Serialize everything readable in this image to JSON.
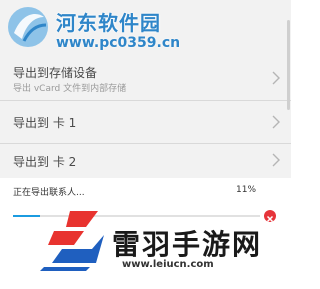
{
  "export_options": [
    {
      "title": "导出到存储设备",
      "subtitle": "导出 vCard 文件到内部存储"
    },
    {
      "title": "导出到 卡 1"
    },
    {
      "title": "导出到 卡 2"
    }
  ],
  "progress": {
    "label": "正在导出联系人...",
    "percent_text": "11%",
    "percent": 11
  },
  "watermark_top": {
    "name": "河东软件园",
    "url": "www.pc0359.cn"
  },
  "watermark_bottom": {
    "name": "雷羽手游网",
    "url": "www.leiucn.com"
  },
  "colors": {
    "accent": "#1b9be0",
    "cancel": "#e6343a",
    "watermark_top": "#2f86c9"
  },
  "icons": {
    "row_chevron": "chevron-right-icon",
    "cancel": "close-circle-icon"
  }
}
